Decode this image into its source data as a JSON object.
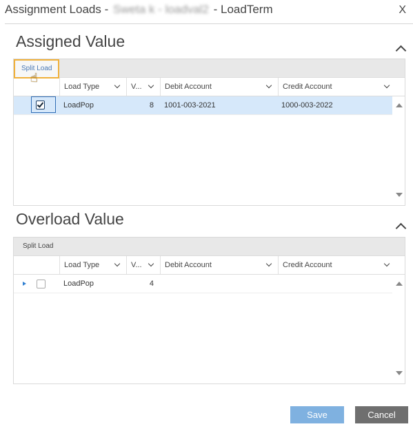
{
  "dialog": {
    "title_prefix": "Assignment Loads -",
    "title_redacted": "Sweta k - loadval2",
    "title_suffix": "- LoadTerm",
    "close_label": "X"
  },
  "assigned": {
    "title": "Assigned Value",
    "toolbar": {
      "split_label": "Split Load"
    },
    "columns": [
      "Load Type",
      "V...",
      "Debit Account",
      "Credit Account"
    ],
    "rows": [
      {
        "load_type": "LoadPop",
        "value": "8",
        "debit": "1001-003-2021",
        "credit": "1000-003-2022",
        "checked": true
      }
    ]
  },
  "overload": {
    "title": "Overload Value",
    "toolbar": {
      "split_label": "Split Load"
    },
    "columns": [
      "Load Type",
      "V...",
      "Debit Account",
      "Credit Account"
    ],
    "rows": [
      {
        "load_type": "LoadPop",
        "value": "4",
        "debit": "",
        "credit": "",
        "checked": false
      }
    ]
  },
  "footer": {
    "save_label": "Save",
    "cancel_label": "Cancel"
  },
  "colors": {
    "accent": "#7fb1e0",
    "selection": "#d6e8fa",
    "focus_outline": "#f0b03a",
    "cancel": "#6f6f6f"
  }
}
